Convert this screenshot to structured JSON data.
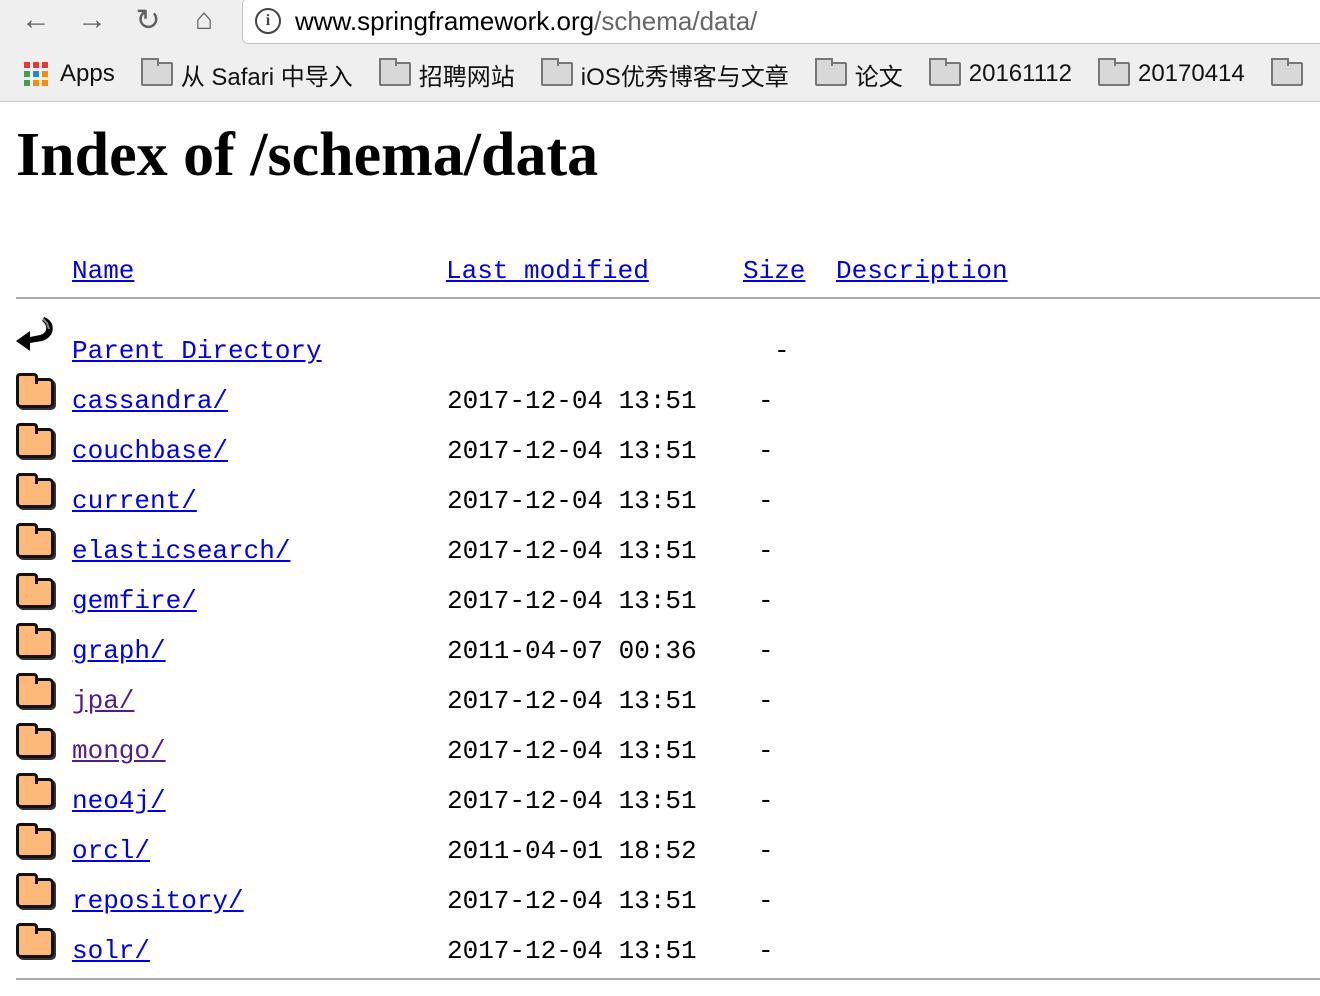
{
  "browser": {
    "url_host": "www.springframework.org",
    "url_path": "/schema/data/",
    "bookmarks": [
      {
        "label": "Apps",
        "icon": "apps-grid-icon"
      },
      {
        "label": "从 Safari 中导入",
        "icon": "folder-icon"
      },
      {
        "label": "招聘网站",
        "icon": "folder-icon"
      },
      {
        "label": "iOS优秀博客与文章",
        "icon": "folder-icon"
      },
      {
        "label": "论文",
        "icon": "folder-icon"
      },
      {
        "label": "20161112",
        "icon": "folder-icon"
      },
      {
        "label": "20170414",
        "icon": "folder-icon"
      },
      {
        "label": "",
        "icon": "folder-icon"
      }
    ]
  },
  "page": {
    "title": "Index of /schema/data",
    "columns": {
      "name": "Name",
      "modified": "Last modified",
      "size": "Size",
      "description": "Description"
    },
    "parent": {
      "name": "Parent Directory",
      "size": "-"
    },
    "entries": [
      {
        "name": "cassandra/",
        "modified": "2017-12-04 13:51",
        "size": "-",
        "visited": false
      },
      {
        "name": "couchbase/",
        "modified": "2017-12-04 13:51",
        "size": "-",
        "visited": false
      },
      {
        "name": "current/",
        "modified": "2017-12-04 13:51",
        "size": "-",
        "visited": false
      },
      {
        "name": "elasticsearch/",
        "modified": "2017-12-04 13:51",
        "size": "-",
        "visited": false
      },
      {
        "name": "gemfire/",
        "modified": "2017-12-04 13:51",
        "size": "-",
        "visited": false
      },
      {
        "name": "graph/",
        "modified": "2011-04-07 00:36",
        "size": "-",
        "visited": false
      },
      {
        "name": "jpa/",
        "modified": "2017-12-04 13:51",
        "size": "-",
        "visited": true
      },
      {
        "name": "mongo/",
        "modified": "2017-12-04 13:51",
        "size": "-",
        "visited": true
      },
      {
        "name": "neo4j/",
        "modified": "2017-12-04 13:51",
        "size": "-",
        "visited": false
      },
      {
        "name": "orcl/",
        "modified": "2011-04-01 18:52",
        "size": "-",
        "visited": false
      },
      {
        "name": "repository/",
        "modified": "2017-12-04 13:51",
        "size": "-",
        "visited": false
      },
      {
        "name": "solr/",
        "modified": "2017-12-04 13:51",
        "size": "-",
        "visited": false
      }
    ]
  }
}
